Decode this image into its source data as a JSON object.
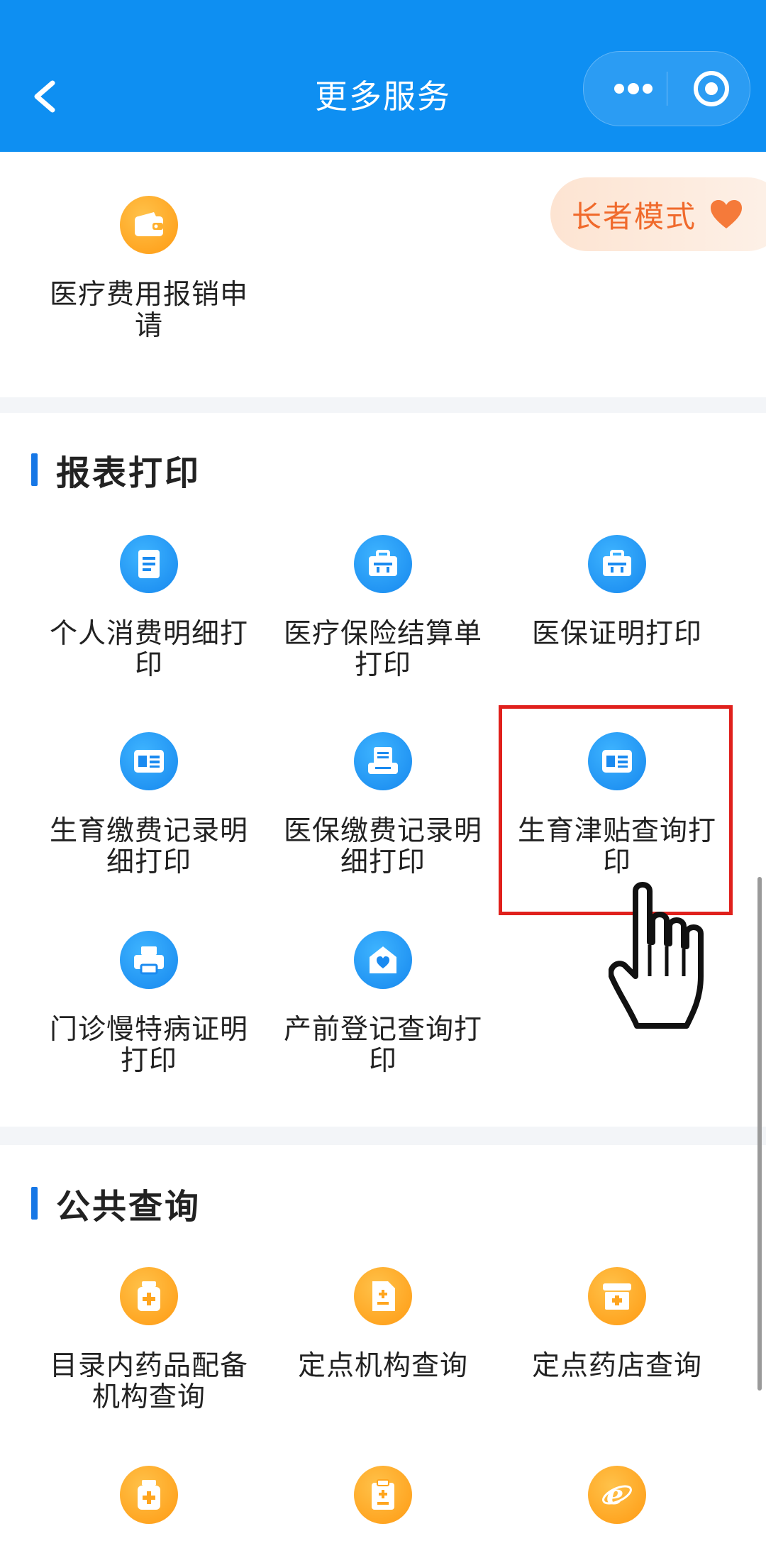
{
  "header": {
    "title": "更多服务",
    "back_icon": "chevron-left-icon",
    "more_icon": "more-dots-icon",
    "close_icon": "target-circle-icon"
  },
  "top_section": {
    "items": [
      {
        "label": "医疗费用报销申请",
        "icon": "wallet-icon"
      }
    ]
  },
  "elder_mode": {
    "label": "长者模式",
    "icon": "heart-icon"
  },
  "report_print": {
    "title": "报表打印",
    "items": [
      {
        "label": "个人消费明细打印",
        "icon": "document-icon"
      },
      {
        "label": "医疗保险结算单打印",
        "icon": "briefcase-icon"
      },
      {
        "label": "医保证明打印",
        "icon": "briefcase-icon"
      },
      {
        "label": "生育缴费记录明细打印",
        "icon": "news-card-icon"
      },
      {
        "label": "医保缴费记录明细打印",
        "icon": "printer-tray-icon"
      },
      {
        "label": "生育津贴查询打印",
        "icon": "news-card-icon"
      },
      {
        "label": "门诊慢特病证明打印",
        "icon": "printer-icon"
      },
      {
        "label": "产前登记查询打印",
        "icon": "house-heart-icon"
      }
    ]
  },
  "public_query": {
    "title": "公共查询",
    "items": [
      {
        "label": "目录内药品配备机构查询",
        "icon": "medicine-bottle-icon"
      },
      {
        "label": "定点机构查询",
        "icon": "medical-file-icon"
      },
      {
        "label": "定点药店查询",
        "icon": "pharmacy-store-icon"
      },
      {
        "label": "",
        "icon": "medicine-bottle-icon"
      },
      {
        "label": "",
        "icon": "clipboard-icon"
      },
      {
        "label": "",
        "icon": "browser-e-icon"
      }
    ]
  },
  "colors": {
    "header_blue": "#0e8ff2",
    "accent_blue": "#1677e6",
    "icon_orange": "#ff9a12",
    "highlight_red": "#e0201c",
    "elder_text": "#f06a2c"
  }
}
